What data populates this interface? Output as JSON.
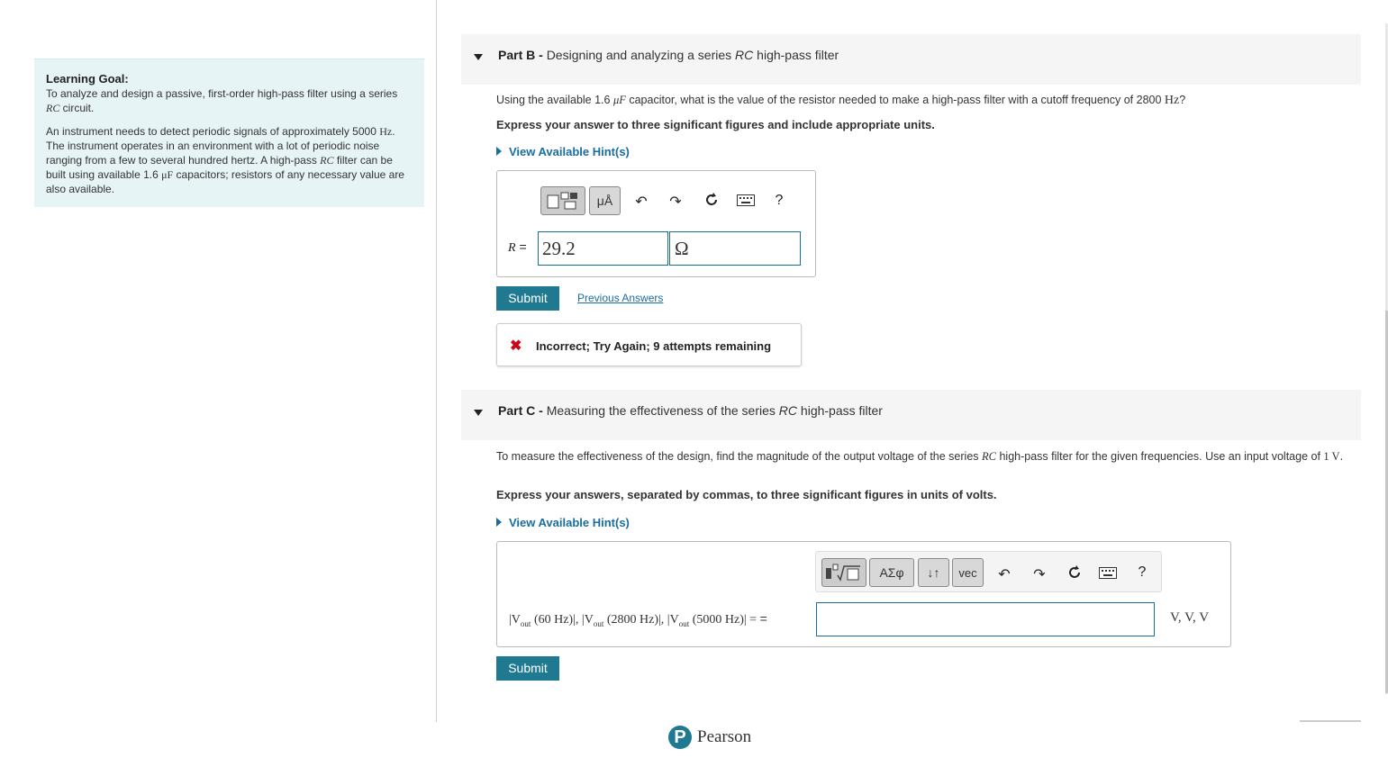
{
  "learning_goal": {
    "heading": "Learning Goal:",
    "line1": "To analyze and design a passive, first-order high-pass filter using a series ",
    "line1_math": "RC",
    "line1_end": " circuit.",
    "para2_a": "An instrument needs to detect periodic signals of approximately 5000 ",
    "para2_hz": "Hz",
    "para2_b": ". The instrument operates in an environment with a lot of periodic noise ranging from a few to several hundred hertz. A high-pass ",
    "para2_rc": "RC",
    "para2_c": " filter can be built using available 1.6 ",
    "para2_unit": "μF",
    "para2_d": " capacitors; resistors of any necessary value are also available."
  },
  "part_b": {
    "label": "Part B",
    "sep": " - ",
    "title_a": "Designing and analyzing a series ",
    "title_rc": "RC",
    "title_b": " high-pass filter",
    "question_a": "Using the available 1.6 ",
    "question_unit": "μF",
    "question_b": " capacitor, what is the value of the resistor needed to make a high-pass filter with a cutoff frequency of 2800 ",
    "question_hz": "Hz",
    "question_c": "?",
    "instruction": "Express your answer to three significant figures and include appropriate units.",
    "hint": "View Available Hint(s)",
    "toolbar": {
      "units_btn": "μÅ",
      "help": "?"
    },
    "answer_label": "R",
    "answer_eq": " =",
    "answer_value": "29.2",
    "answer_unit": "Ω",
    "submit": "Submit",
    "previous_answers": "Previous Answers",
    "feedback_icon": "✖",
    "feedback": "Incorrect; Try Again; 9 attempts remaining"
  },
  "part_c": {
    "label": "Part C",
    "sep": " - ",
    "title_a": "Measuring the effectiveness of the series ",
    "title_rc": "RC",
    "title_b": " high-pass filter",
    "question_a": "To measure the effectiveness of the design, find the magnitude of the output voltage of the series ",
    "question_rc": "RC",
    "question_b": " high-pass filter for the given frequencies. Use an input voltage of ",
    "question_v": "1 V",
    "question_c": ".",
    "instruction": "Express your answers, separated by commas, to three significant figures in units of volts.",
    "hint": "View Available Hint(s)",
    "toolbar": {
      "greek_btn": "ΑΣφ",
      "sort_btn": "↓↑",
      "vec_btn": "vec",
      "help": "?"
    },
    "answer_label": "|Vout (60 Hz)|, |Vout (2800 Hz)|, |Vout (5000 Hz)| =",
    "answer_label_parts": [
      "|V",
      "out",
      " (60 Hz)|, |V",
      "out",
      " (2800 Hz)|, |V",
      "out",
      " (5000 Hz)| = "
    ],
    "answer_eq": "=",
    "answer_value": "",
    "answer_units": "V, V, V",
    "submit": "Submit"
  },
  "footer": {
    "brand": "Pearson",
    "logo_letter": "P"
  },
  "colors": {
    "accent": "#1f7a91",
    "link": "#1a6e9e",
    "goal_bg": "#e6f4f5",
    "error": "#d0021b"
  }
}
